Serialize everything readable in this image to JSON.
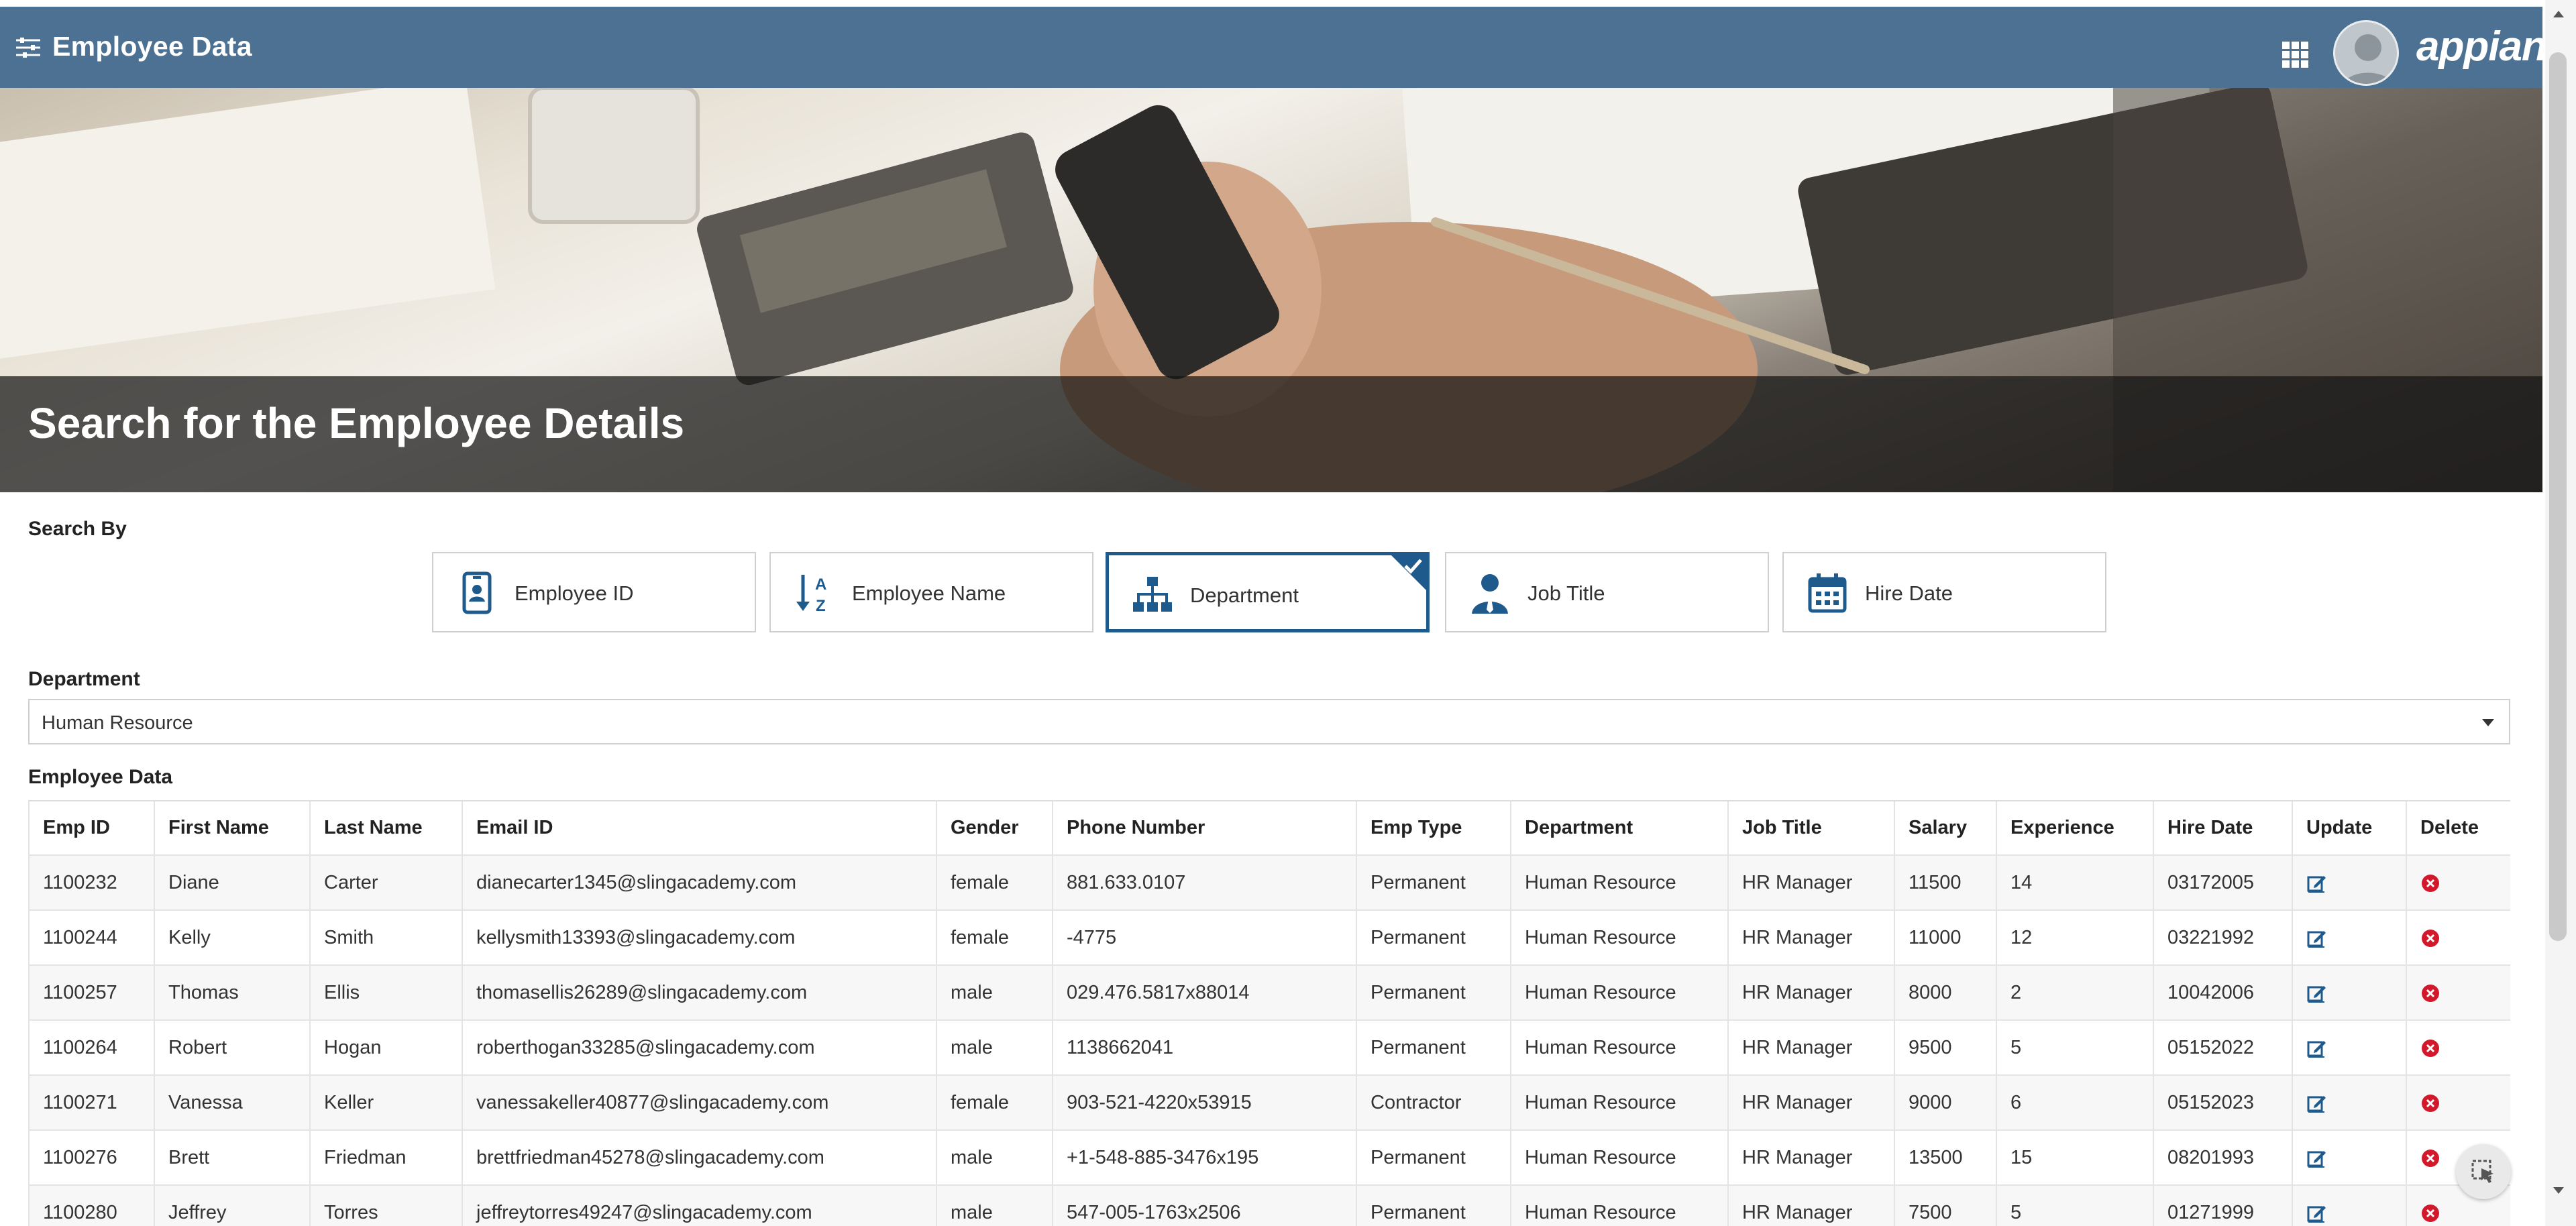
{
  "header": {
    "title": "Employee Data",
    "logo_text": "appian",
    "brand_color": "#4c7192"
  },
  "banner": {
    "caption": "Search for the Employee Details"
  },
  "search": {
    "label": "Search By",
    "options": [
      {
        "label": "Employee ID",
        "icon": "id-card-icon",
        "selected": false
      },
      {
        "label": "Employee Name",
        "icon": "sort-alpha-icon",
        "selected": false
      },
      {
        "label": "Department",
        "icon": "org-chart-icon",
        "selected": true
      },
      {
        "label": "Job Title",
        "icon": "user-tie-icon",
        "selected": false
      },
      {
        "label": "Hire Date",
        "icon": "calendar-icon",
        "selected": false
      }
    ],
    "accent_color": "#1f5a8d"
  },
  "department": {
    "label": "Department",
    "selected_value": "Human Resource"
  },
  "table": {
    "label": "Employee Data",
    "columns": [
      "Emp ID",
      "First Name",
      "Last Name",
      "Email ID",
      "Gender",
      "Phone Number",
      "Emp Type",
      "Department",
      "Job Title",
      "Salary",
      "Experience",
      "Hire Date",
      "Update",
      "Delete"
    ],
    "rows": [
      [
        "1100232",
        "Diane",
        "Carter",
        "dianecarter1345@slingacademy.com",
        "female",
        "881.633.0107",
        "Permanent",
        "Human Resource",
        "HR Manager",
        "11500",
        "14",
        "03172005"
      ],
      [
        "1100244",
        "Kelly",
        "Smith",
        "kellysmith13393@slingacademy.com",
        "female",
        "-4775",
        "Permanent",
        "Human Resource",
        "HR Manager",
        "11000",
        "12",
        "03221992"
      ],
      [
        "1100257",
        "Thomas",
        "Ellis",
        "thomasellis26289@slingacademy.com",
        "male",
        "029.476.5817x88014",
        "Permanent",
        "Human Resource",
        "HR Manager",
        "8000",
        "2",
        "10042006"
      ],
      [
        "1100264",
        "Robert",
        "Hogan",
        "roberthogan33285@slingacademy.com",
        "male",
        "1138662041",
        "Permanent",
        "Human Resource",
        "HR Manager",
        "9500",
        "5",
        "05152022"
      ],
      [
        "1100271",
        "Vanessa",
        "Keller",
        "vanessakeller40877@slingacademy.com",
        "female",
        "903-521-4220x53915",
        "Contractor",
        "Human Resource",
        "HR Manager",
        "9000",
        "6",
        "05152023"
      ],
      [
        "1100276",
        "Brett",
        "Friedman",
        "brettfriedman45278@slingacademy.com",
        "male",
        "+1-548-885-3476x195",
        "Permanent",
        "Human Resource",
        "HR Manager",
        "13500",
        "15",
        "08201993"
      ],
      [
        "1100280",
        "Jeffrey",
        "Torres",
        "jeffreytorres49247@slingacademy.com",
        "male",
        "547-005-1763x2506",
        "Permanent",
        "Human Resource",
        "HR Manager",
        "7500",
        "5",
        "01271999"
      ]
    ],
    "update_icon": "edit-icon",
    "delete_icon": "delete-circle-icon",
    "update_color": "#1f5a8d",
    "delete_color": "#d3182b"
  }
}
